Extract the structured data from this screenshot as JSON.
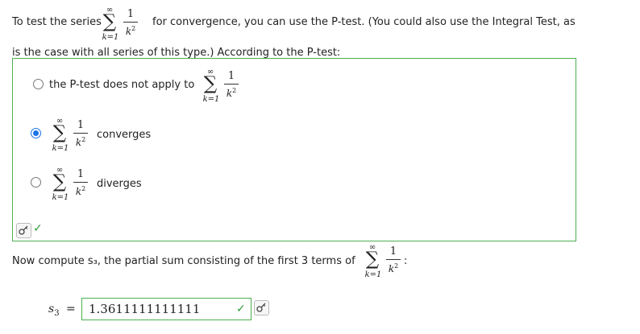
{
  "intro": {
    "before": "To test the series",
    "after": "for convergence, you can use the P-test. (You could also use the Integral Test, as",
    "line2": "is the case with all series of this type.) According to the P-test:"
  },
  "series": {
    "upper": "∞",
    "sigma": "∑",
    "lower": "k=1",
    "numerator": "1",
    "denominator_base": "k",
    "denominator_exp": "2"
  },
  "options": [
    {
      "label": "the P-test does not apply to",
      "selected": false
    },
    {
      "label": "converges",
      "selected": true
    },
    {
      "label": "diverges",
      "selected": false
    }
  ],
  "partial": {
    "prompt": "Now compute s₃, the partial sum consisting of the first 3 terms of",
    "trailing": ":",
    "var_base": "s",
    "var_sub": "3",
    "equals": "=",
    "value": "1.3611111111111"
  },
  "icons": {
    "key": "key-icon",
    "check": "checkmark-icon"
  },
  "colors": {
    "correct": "#4caf50",
    "radio_selected": "#1a73e8"
  }
}
